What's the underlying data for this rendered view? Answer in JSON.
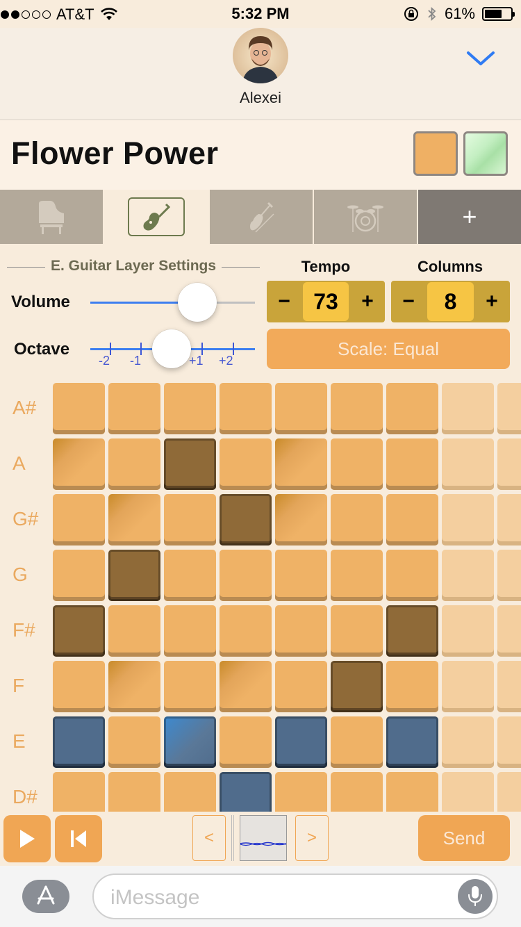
{
  "status": {
    "carrier": "AT&T",
    "time": "5:32 PM",
    "battery": "61%",
    "signal_bars_filled": 2,
    "battery_level": 0.61
  },
  "contact": {
    "name": "Alexei"
  },
  "song": {
    "title": "Flower Power"
  },
  "swatch_colors": [
    "#efb064",
    "#c6f1c4"
  ],
  "tabs": [
    {
      "icon": "piano-icon",
      "active": false
    },
    {
      "icon": "electric-guitar-icon",
      "active": true
    },
    {
      "icon": "violin-icon",
      "active": false
    },
    {
      "icon": "drum-kit-icon",
      "active": false
    },
    {
      "icon": "plus-icon",
      "label": "+",
      "active": false
    }
  ],
  "layer_settings": {
    "heading": "E. Guitar Layer Settings",
    "volume_label": "Volume",
    "volume_level": 0.7,
    "octave_label": "Octave",
    "octave_ticks": [
      "-2",
      "-1",
      "+1",
      "+2"
    ],
    "octave_value": 0
  },
  "tempo": {
    "label": "Tempo",
    "value": "73",
    "minus": "−",
    "plus": "+"
  },
  "columns": {
    "label": "Columns",
    "value": "8",
    "minus": "−",
    "plus": "+"
  },
  "scale": {
    "label": "Scale: Equal"
  },
  "grid": {
    "rows": [
      "A#",
      "A",
      "G#",
      "G",
      "F#",
      "F",
      "E",
      "D#"
    ],
    "states": [
      "........",
      "g.d.g...",
      ".g.dg...",
      ".d......",
      "d.....d.",
      ".g.g.d..",
      "b.B.b.b.",
      "...b...."
    ]
  },
  "controls": {
    "prev_label": "<",
    "next_label": ">",
    "send_label": "Send"
  },
  "input": {
    "placeholder": "iMessage"
  },
  "colors": {
    "accent_orange": "#f0a654",
    "cell": "#efb266",
    "cell_dark": "#8f6a38",
    "cell_blue": "#506c8c",
    "slider_blue": "#3d7ef0",
    "chevron_blue": "#2f7bf3"
  }
}
